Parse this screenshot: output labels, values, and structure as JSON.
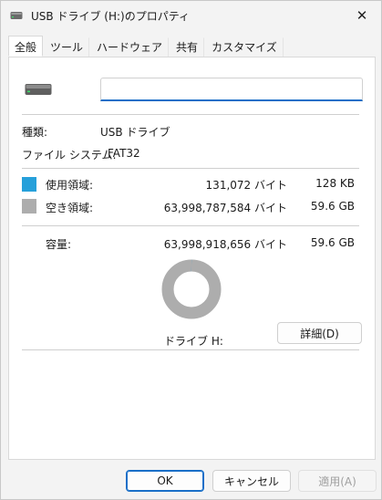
{
  "window": {
    "title": "USB ドライブ (H:)のプロパティ",
    "close_glyph": "✕"
  },
  "tabs": [
    {
      "label": "全般",
      "active": true
    },
    {
      "label": "ツール",
      "active": false
    },
    {
      "label": "ハードウェア",
      "active": false
    },
    {
      "label": "共有",
      "active": false
    },
    {
      "label": "カスタマイズ",
      "active": false
    }
  ],
  "general": {
    "name_value": "",
    "type_label": "種類:",
    "type_value": "USB ドライブ",
    "fs_label": "ファイル システム:",
    "fs_value": "FAT32",
    "used_label": "使用領域:",
    "used_bytes": "131,072 バイト",
    "used_size": "128 KB",
    "free_label": "空き領域:",
    "free_bytes": "63,998,787,584 バイト",
    "free_size": "59.6 GB",
    "capacity_label": "容量:",
    "capacity_bytes": "63,998,918,656 バイト",
    "capacity_size": "59.6 GB",
    "drive_label": "ドライブ H:",
    "detail_button": "詳細(D)",
    "used_fraction": 2e-06
  },
  "colors": {
    "used": "#26a0da",
    "free": "#adadad",
    "accent": "#1a6fc8"
  },
  "buttons": {
    "ok": "OK",
    "cancel": "キャンセル",
    "apply": "適用(A)"
  }
}
